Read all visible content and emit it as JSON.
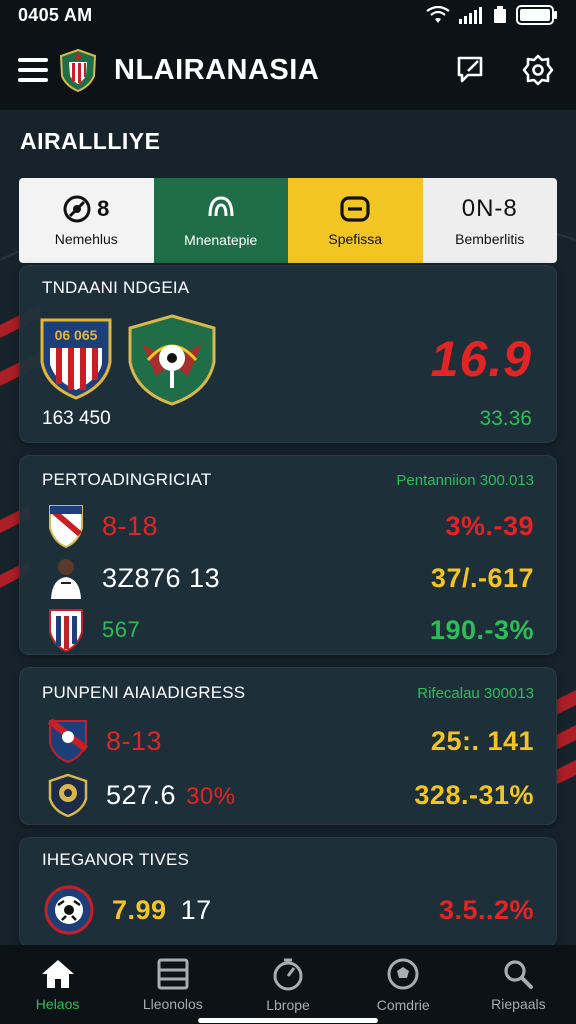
{
  "status": {
    "time": "0405 AM"
  },
  "app": {
    "title": "NLAIRANASIA"
  },
  "section": {
    "title": "AIRALLLIYE"
  },
  "tabs": [
    {
      "value": "8",
      "label": "Nemehlus",
      "icon": "ball-icon"
    },
    {
      "value": "",
      "label": "Mnenatepie",
      "icon": "shield-icon"
    },
    {
      "value": "",
      "label": "Spefissa",
      "icon": "calendar-icon"
    },
    {
      "value": "0N-8",
      "label": "Bemberlitis",
      "icon": ""
    }
  ],
  "featured": {
    "title": "TNDAANI NDGEIA",
    "team_a_crest_text": "06 065",
    "score": "16.9",
    "left_stat": "163 450",
    "right_stat": "33.36"
  },
  "card_b": {
    "title": "PERTOADINGRICIAT",
    "subtitle": "Pentanniion 300.013",
    "rows": [
      {
        "value": "8-18",
        "right": "3%.-39"
      },
      {
        "value": "3Z876 13",
        "right": "37/.-617"
      },
      {
        "value": "567",
        "right": "190.-3%"
      }
    ]
  },
  "card_c": {
    "title": "PUNPENI AIAIADIGRESS",
    "subtitle": "Rifecalau 300013",
    "rows": [
      {
        "value": "8-13",
        "right": "25:. 141"
      },
      {
        "value": "527.6",
        "value_b": "30%",
        "right": "328.-31%"
      }
    ]
  },
  "card_d": {
    "title": "IHEGANOR TIVES",
    "rows": [
      {
        "value": "7.99",
        "value_b": "17",
        "right": "3.5..2%"
      }
    ]
  },
  "nav": [
    {
      "label": "Helaos",
      "icon": "home-icon",
      "active": true
    },
    {
      "label": "Lleonolos",
      "icon": "list-icon",
      "active": false
    },
    {
      "label": "Lbrope",
      "icon": "timer-icon",
      "active": false
    },
    {
      "label": "Comdrie",
      "icon": "ball-icon",
      "active": false
    },
    {
      "label": "Riepaals",
      "icon": "search-icon",
      "active": false
    }
  ],
  "colors": {
    "accent_green": "#2fbd58",
    "accent_red": "#e42424",
    "accent_yellow": "#f2c523",
    "background": "#17232b",
    "card": "#1e313b"
  }
}
